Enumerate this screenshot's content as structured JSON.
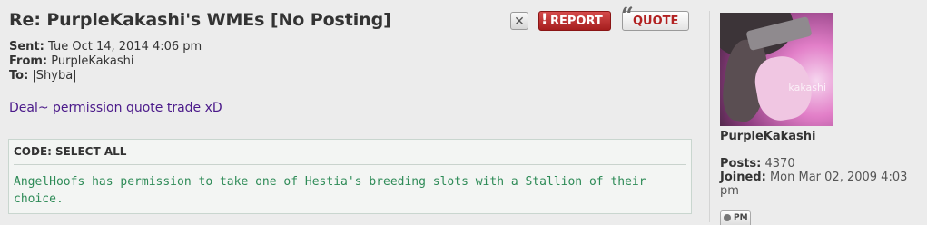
{
  "post": {
    "title": "Re: PurpleKakashi's WMEs [No Posting]",
    "buttons": {
      "close_icon": "close-icon",
      "report_label": "REPORT",
      "quote_label": "QUOTE"
    },
    "meta": {
      "sent_label": "Sent:",
      "sent_value": "Tue Oct 14, 2014 4:06 pm",
      "from_label": "From:",
      "from_value": "PurpleKakashi",
      "to_label": "To:",
      "to_value": "|Shyba|"
    },
    "message": "Deal~ permission quote trade xD",
    "code": {
      "label": "CODE:",
      "select_all": "SELECT ALL",
      "text": "AngelHoofs has permission to take one of Hestia's breeding slots with a Stallion of their choice."
    }
  },
  "profile": {
    "avatar_watermark": "kakashi",
    "username": "PurpleKakashi",
    "posts_label": "Posts:",
    "posts_value": "4370",
    "joined_label": "Joined:",
    "joined_value": "Mon Mar 02, 2009 4:03 pm",
    "pm_label": "PM"
  },
  "colors": {
    "message_text": "#4b1a8a",
    "code_text": "#2e8b57",
    "report_bg": "#b22222",
    "background": "#ececec"
  }
}
